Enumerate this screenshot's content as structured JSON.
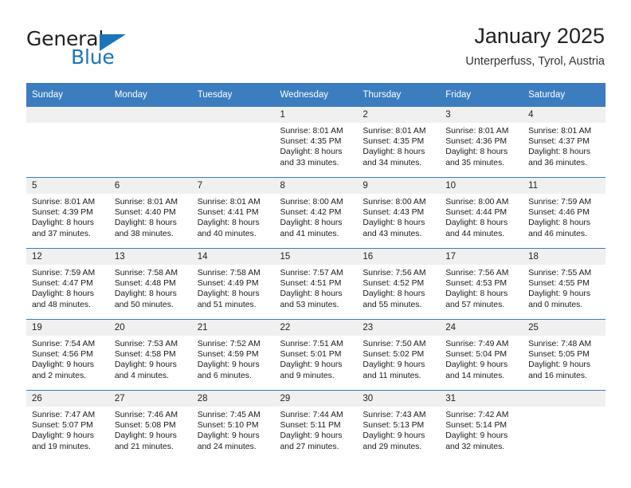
{
  "brand": {
    "name_top": "General",
    "name_bottom": "Blue",
    "accent_color": "#1b75bb"
  },
  "header": {
    "title": "January 2025",
    "subtitle": "Unterperfuss, Tyrol, Austria"
  },
  "calendar": {
    "header_bg": "#3b7dbf",
    "daynum_bg": "#f0f0f0",
    "weekday_headers": [
      "Sunday",
      "Monday",
      "Tuesday",
      "Wednesday",
      "Thursday",
      "Friday",
      "Saturday"
    ],
    "weeks": [
      [
        {
          "day": "",
          "lines": [
            "",
            "",
            "",
            ""
          ]
        },
        {
          "day": "",
          "lines": [
            "",
            "",
            "",
            ""
          ]
        },
        {
          "day": "",
          "lines": [
            "",
            "",
            "",
            ""
          ]
        },
        {
          "day": "1",
          "lines": [
            "Sunrise: 8:01 AM",
            "Sunset: 4:35 PM",
            "Daylight: 8 hours",
            "and 33 minutes."
          ]
        },
        {
          "day": "2",
          "lines": [
            "Sunrise: 8:01 AM",
            "Sunset: 4:35 PM",
            "Daylight: 8 hours",
            "and 34 minutes."
          ]
        },
        {
          "day": "3",
          "lines": [
            "Sunrise: 8:01 AM",
            "Sunset: 4:36 PM",
            "Daylight: 8 hours",
            "and 35 minutes."
          ]
        },
        {
          "day": "4",
          "lines": [
            "Sunrise: 8:01 AM",
            "Sunset: 4:37 PM",
            "Daylight: 8 hours",
            "and 36 minutes."
          ]
        }
      ],
      [
        {
          "day": "5",
          "lines": [
            "Sunrise: 8:01 AM",
            "Sunset: 4:39 PM",
            "Daylight: 8 hours",
            "and 37 minutes."
          ]
        },
        {
          "day": "6",
          "lines": [
            "Sunrise: 8:01 AM",
            "Sunset: 4:40 PM",
            "Daylight: 8 hours",
            "and 38 minutes."
          ]
        },
        {
          "day": "7",
          "lines": [
            "Sunrise: 8:01 AM",
            "Sunset: 4:41 PM",
            "Daylight: 8 hours",
            "and 40 minutes."
          ]
        },
        {
          "day": "8",
          "lines": [
            "Sunrise: 8:00 AM",
            "Sunset: 4:42 PM",
            "Daylight: 8 hours",
            "and 41 minutes."
          ]
        },
        {
          "day": "9",
          "lines": [
            "Sunrise: 8:00 AM",
            "Sunset: 4:43 PM",
            "Daylight: 8 hours",
            "and 43 minutes."
          ]
        },
        {
          "day": "10",
          "lines": [
            "Sunrise: 8:00 AM",
            "Sunset: 4:44 PM",
            "Daylight: 8 hours",
            "and 44 minutes."
          ]
        },
        {
          "day": "11",
          "lines": [
            "Sunrise: 7:59 AM",
            "Sunset: 4:46 PM",
            "Daylight: 8 hours",
            "and 46 minutes."
          ]
        }
      ],
      [
        {
          "day": "12",
          "lines": [
            "Sunrise: 7:59 AM",
            "Sunset: 4:47 PM",
            "Daylight: 8 hours",
            "and 48 minutes."
          ]
        },
        {
          "day": "13",
          "lines": [
            "Sunrise: 7:58 AM",
            "Sunset: 4:48 PM",
            "Daylight: 8 hours",
            "and 50 minutes."
          ]
        },
        {
          "day": "14",
          "lines": [
            "Sunrise: 7:58 AM",
            "Sunset: 4:49 PM",
            "Daylight: 8 hours",
            "and 51 minutes."
          ]
        },
        {
          "day": "15",
          "lines": [
            "Sunrise: 7:57 AM",
            "Sunset: 4:51 PM",
            "Daylight: 8 hours",
            "and 53 minutes."
          ]
        },
        {
          "day": "16",
          "lines": [
            "Sunrise: 7:56 AM",
            "Sunset: 4:52 PM",
            "Daylight: 8 hours",
            "and 55 minutes."
          ]
        },
        {
          "day": "17",
          "lines": [
            "Sunrise: 7:56 AM",
            "Sunset: 4:53 PM",
            "Daylight: 8 hours",
            "and 57 minutes."
          ]
        },
        {
          "day": "18",
          "lines": [
            "Sunrise: 7:55 AM",
            "Sunset: 4:55 PM",
            "Daylight: 9 hours",
            "and 0 minutes."
          ]
        }
      ],
      [
        {
          "day": "19",
          "lines": [
            "Sunrise: 7:54 AM",
            "Sunset: 4:56 PM",
            "Daylight: 9 hours",
            "and 2 minutes."
          ]
        },
        {
          "day": "20",
          "lines": [
            "Sunrise: 7:53 AM",
            "Sunset: 4:58 PM",
            "Daylight: 9 hours",
            "and 4 minutes."
          ]
        },
        {
          "day": "21",
          "lines": [
            "Sunrise: 7:52 AM",
            "Sunset: 4:59 PM",
            "Daylight: 9 hours",
            "and 6 minutes."
          ]
        },
        {
          "day": "22",
          "lines": [
            "Sunrise: 7:51 AM",
            "Sunset: 5:01 PM",
            "Daylight: 9 hours",
            "and 9 minutes."
          ]
        },
        {
          "day": "23",
          "lines": [
            "Sunrise: 7:50 AM",
            "Sunset: 5:02 PM",
            "Daylight: 9 hours",
            "and 11 minutes."
          ]
        },
        {
          "day": "24",
          "lines": [
            "Sunrise: 7:49 AM",
            "Sunset: 5:04 PM",
            "Daylight: 9 hours",
            "and 14 minutes."
          ]
        },
        {
          "day": "25",
          "lines": [
            "Sunrise: 7:48 AM",
            "Sunset: 5:05 PM",
            "Daylight: 9 hours",
            "and 16 minutes."
          ]
        }
      ],
      [
        {
          "day": "26",
          "lines": [
            "Sunrise: 7:47 AM",
            "Sunset: 5:07 PM",
            "Daylight: 9 hours",
            "and 19 minutes."
          ]
        },
        {
          "day": "27",
          "lines": [
            "Sunrise: 7:46 AM",
            "Sunset: 5:08 PM",
            "Daylight: 9 hours",
            "and 21 minutes."
          ]
        },
        {
          "day": "28",
          "lines": [
            "Sunrise: 7:45 AM",
            "Sunset: 5:10 PM",
            "Daylight: 9 hours",
            "and 24 minutes."
          ]
        },
        {
          "day": "29",
          "lines": [
            "Sunrise: 7:44 AM",
            "Sunset: 5:11 PM",
            "Daylight: 9 hours",
            "and 27 minutes."
          ]
        },
        {
          "day": "30",
          "lines": [
            "Sunrise: 7:43 AM",
            "Sunset: 5:13 PM",
            "Daylight: 9 hours",
            "and 29 minutes."
          ]
        },
        {
          "day": "31",
          "lines": [
            "Sunrise: 7:42 AM",
            "Sunset: 5:14 PM",
            "Daylight: 9 hours",
            "and 32 minutes."
          ]
        },
        {
          "day": "",
          "lines": [
            "",
            "",
            "",
            ""
          ]
        }
      ]
    ]
  }
}
